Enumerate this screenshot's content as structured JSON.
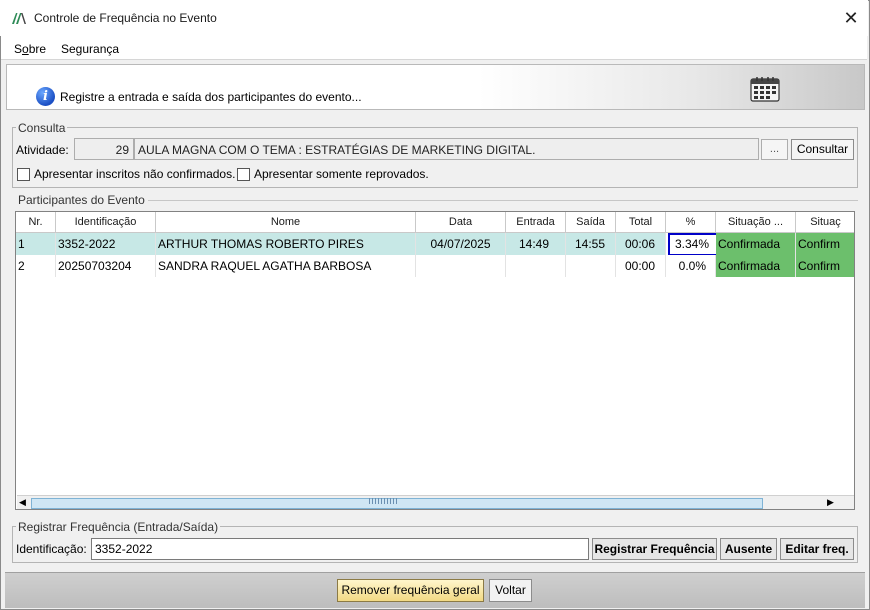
{
  "window": {
    "title": "Controle de Frequência no Evento"
  },
  "menu": {
    "items": [
      {
        "label": "Sobre",
        "mnemonic": "o"
      },
      {
        "label": "Segurança"
      }
    ]
  },
  "banner": {
    "text": "Registre a entrada e saída dos participantes do evento..."
  },
  "consulta": {
    "group_label": "Consulta",
    "atividade_label": "Atividade:",
    "atividade_id": "29",
    "atividade_name": "AULA MAGNA COM O TEMA : ESTRATÉGIAS DE MARKETING DIGITAL.",
    "ellipsis_label": "...",
    "consultar_label": "Consultar",
    "check_nao_confirmados": "Apresentar inscritos não confirmados.",
    "check_reprovados": "Apresentar somente reprovados."
  },
  "participantes": {
    "group_label": "Participantes do Evento",
    "columns": [
      "Nr.",
      "Identificação",
      "Nome",
      "Data",
      "Entrada",
      "Saída",
      "Total",
      "%",
      "Situação ...",
      "Situaç"
    ],
    "rows": [
      [
        "1",
        "3352-2022",
        "ARTHUR THOMAS ROBERTO PIRES",
        "04/07/2025",
        "14:49",
        "14:55",
        "00:06",
        "3.34%",
        "Confirmada",
        "Confirm"
      ],
      [
        "2",
        "20250703204",
        "SANDRA RAQUEL AGATHA BARBOSA",
        "",
        "",
        "",
        "00:00",
        "0.0%",
        "Confirmada",
        "Confirm"
      ]
    ],
    "status_color": "#6cbf6c",
    "selected_row_color": "#c7e8e6"
  },
  "registrar": {
    "group_label": "Registrar Frequência (Entrada/Saída)",
    "ident_label": "Identificação:",
    "ident_value": "3352-2022",
    "registrar_label": "Registrar Frequência",
    "ausente_label": "Ausente",
    "editar_label": "Editar freq."
  },
  "footer": {
    "remover_label": "Remover frequência geral",
    "voltar_label": "Voltar"
  }
}
